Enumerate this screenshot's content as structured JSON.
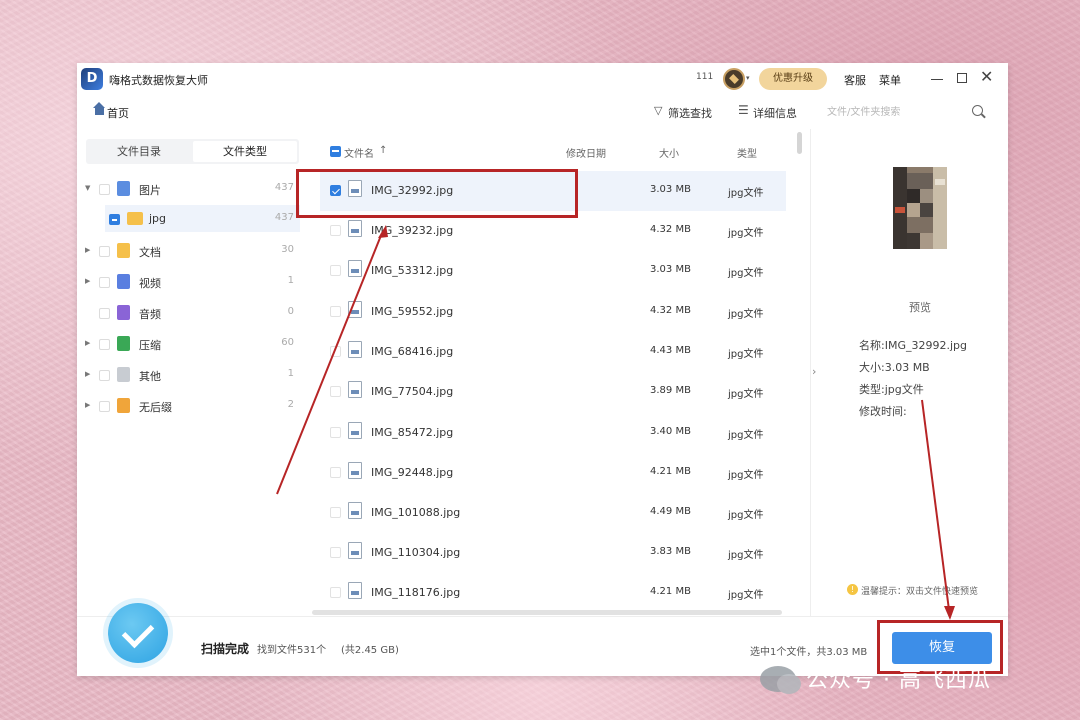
{
  "titlebar": {
    "logo_letter": "D",
    "app_title": "嗨格式数据恢复大师",
    "count": "111",
    "upgrade_label": "优惠升级",
    "service_label": "客服",
    "menu_label": "菜单"
  },
  "navbar": {
    "home_label": "首页",
    "filter_label": "筛选查找",
    "details_label": "详细信息",
    "search_placeholder": "文件/文件夹搜索"
  },
  "left_tabs": {
    "directory": "文件目录",
    "type": "文件类型"
  },
  "tree": [
    {
      "label": "图片",
      "count": "437",
      "color": "#5b8de0"
    },
    {
      "label": "jpg",
      "count": "437",
      "color": "#f5c04a"
    },
    {
      "label": "文档",
      "count": "30",
      "color": "#f5c04a"
    },
    {
      "label": "视频",
      "count": "1",
      "color": "#5a7fe0"
    },
    {
      "label": "音频",
      "count": "0",
      "color": "#8a64d6"
    },
    {
      "label": "压缩",
      "count": "60",
      "color": "#3aa856"
    },
    {
      "label": "其他",
      "count": "1",
      "color": "#c8ccd2"
    },
    {
      "label": "无后缀",
      "count": "2",
      "color": "#f0a53a"
    }
  ],
  "list_header": {
    "name": "文件名",
    "sort_icon": "↑",
    "modified": "修改日期",
    "size": "大小",
    "type": "类型"
  },
  "files": [
    {
      "name": "IMG_32992.jpg",
      "size": "3.03 MB",
      "type": "jpg文件"
    },
    {
      "name": "IMG_39232.jpg",
      "size": "4.32 MB",
      "type": "jpg文件"
    },
    {
      "name": "IMG_53312.jpg",
      "size": "3.03 MB",
      "type": "jpg文件"
    },
    {
      "name": "IMG_59552.jpg",
      "size": "4.32 MB",
      "type": "jpg文件"
    },
    {
      "name": "IMG_68416.jpg",
      "size": "4.43 MB",
      "type": "jpg文件"
    },
    {
      "name": "IMG_77504.jpg",
      "size": "3.89 MB",
      "type": "jpg文件"
    },
    {
      "name": "IMG_85472.jpg",
      "size": "3.40 MB",
      "type": "jpg文件"
    },
    {
      "name": "IMG_92448.jpg",
      "size": "4.21 MB",
      "type": "jpg文件"
    },
    {
      "name": "IMG_101088.jpg",
      "size": "4.49 MB",
      "type": "jpg文件"
    },
    {
      "name": "IMG_110304.jpg",
      "size": "3.83 MB",
      "type": "jpg文件"
    },
    {
      "name": "IMG_118176.jpg",
      "size": "4.21 MB",
      "type": "jpg文件"
    }
  ],
  "preview": {
    "label": "预览",
    "name_line": "名称:IMG_32992.jpg",
    "size_line": "大小:3.03 MB",
    "type_line": "类型:jpg文件",
    "modified_line": "修改时间:",
    "hint_icon": "!",
    "hint": "温馨提示：双击文件快速预览"
  },
  "footer": {
    "scan_done": "扫描完成",
    "found": "找到文件531个",
    "total": "(共2.45 GB)",
    "selected": "选中1个文件，共3.03 MB",
    "recover_label": "恢复"
  },
  "watermark": "公众号 · 高飞西瓜",
  "colors": {
    "accent": "#3d8ee8",
    "annotation": "#b72526",
    "upgrade": "#f2d59c",
    "selection": "#eef3fb"
  }
}
